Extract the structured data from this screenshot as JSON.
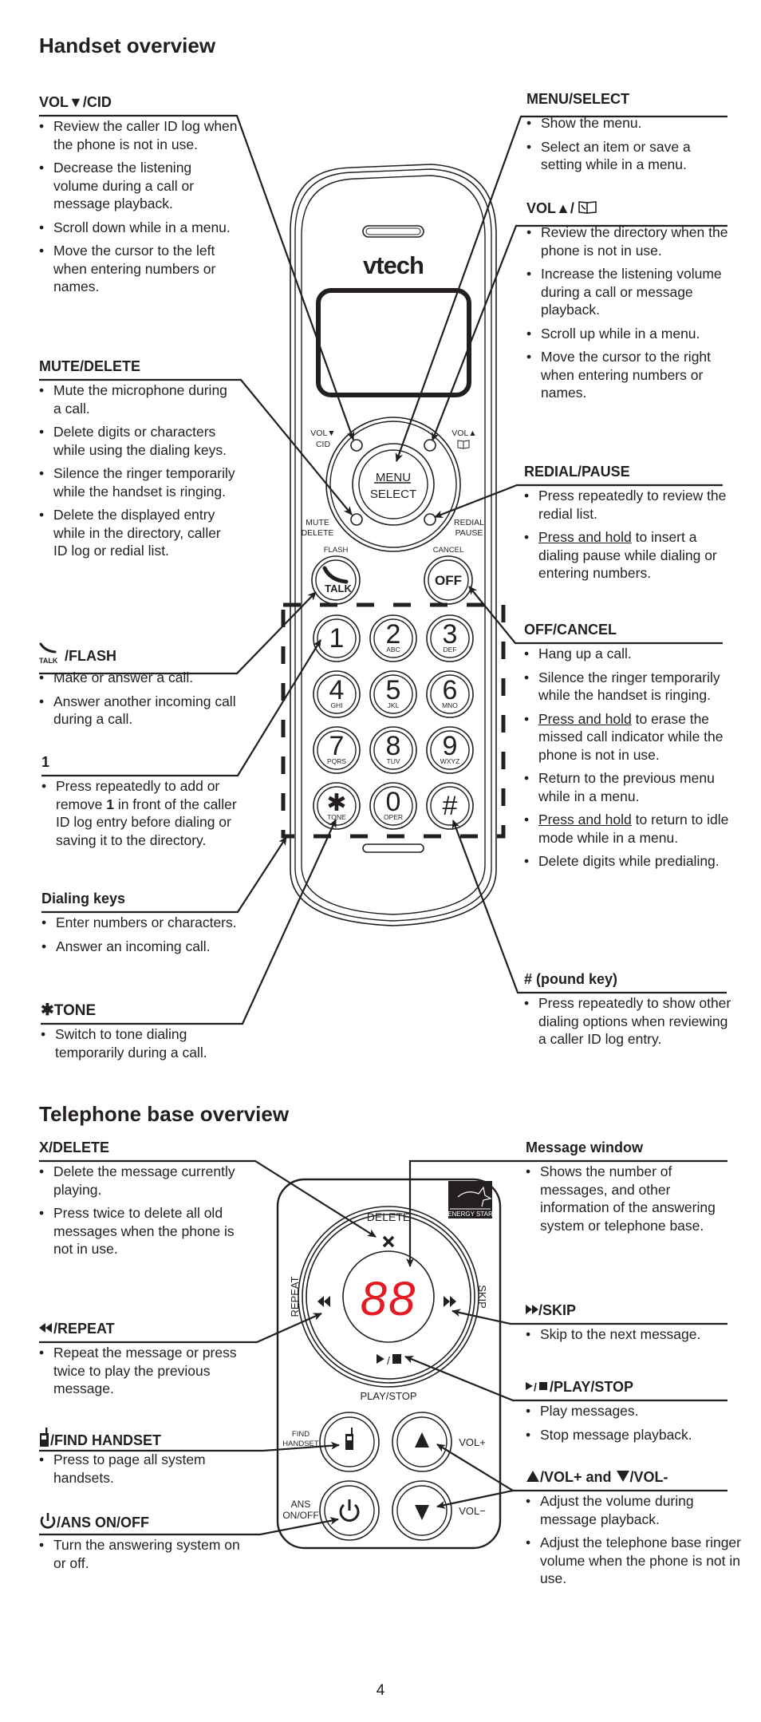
{
  "handset": {
    "heading": "Handset overview",
    "brand": "vtech",
    "keypad": [
      {
        "digit": "1",
        "letters": ""
      },
      {
        "digit": "2",
        "letters": "ABC"
      },
      {
        "digit": "3",
        "letters": "DEF"
      },
      {
        "digit": "4",
        "letters": "GHI"
      },
      {
        "digit": "5",
        "letters": "JKL"
      },
      {
        "digit": "6",
        "letters": "MNO"
      },
      {
        "digit": "7",
        "letters": "PQRS"
      },
      {
        "digit": "8",
        "letters": "TUV"
      },
      {
        "digit": "9",
        "letters": "WXYZ"
      },
      {
        "digit": "✱",
        "letters": "TONE"
      },
      {
        "digit": "0",
        "letters": "OPER"
      },
      {
        "digit": "#",
        "letters": ""
      }
    ],
    "labels": {
      "vol_down": "VOL▼",
      "cid": "CID",
      "vol_up": "VOL▲",
      "menu": "MENU",
      "select": "SELECT",
      "mute": "MUTE",
      "delete": "DELETE",
      "redial": "REDIAL",
      "pause": "PAUSE",
      "flash": "FLASH",
      "talk": "TALK",
      "cancel": "CANCEL",
      "off": "OFF"
    },
    "callouts": {
      "vol_cid": {
        "title": "VOL▼/CID",
        "items": [
          "Review the caller ID log when the phone is not in use.",
          "Decrease the listening volume during a call or message playback.",
          "Scroll down while in a menu.",
          "Move the cursor to the left when entering numbers or names."
        ]
      },
      "mute_delete": {
        "title": "MUTE/DELETE",
        "items": [
          "Mute the microphone during a call.",
          "Delete digits or characters while using the dialing keys.",
          "Silence the ringer temporarily while the handset is ringing.",
          "Delete the displayed entry while in the directory, caller ID log or redial list."
        ]
      },
      "talk_flash": {
        "title_icon_label": "TALK",
        "title": "/FLASH",
        "items": [
          "Make or answer a call.",
          "Answer another incoming call during a call."
        ]
      },
      "one": {
        "title": "1",
        "item_pre": "Press repeatedly to add or remove ",
        "item_bold": "1",
        "item_post": " in front of the caller ID log entry before dialing or saving it to the directory."
      },
      "dialing_keys": {
        "title": "Dialing keys",
        "items": [
          "Enter numbers or characters.",
          "Answer an incoming call."
        ]
      },
      "tone": {
        "title_icon": "✱",
        "title": "TONE",
        "items": [
          "Switch to tone dialing temporarily during a call."
        ]
      },
      "menu_select": {
        "title": "MENU/SELECT",
        "items": [
          "Show the menu.",
          "Select an item or save a setting while in a menu."
        ]
      },
      "vol_directory": {
        "title": "VOL▲/",
        "items": [
          "Review the directory when the phone is not in use.",
          "Increase the listening volume during a call or message playback.",
          "Scroll up while in a menu.",
          "Move the cursor to the right when entering numbers or names."
        ]
      },
      "redial_pause": {
        "title": "REDIAL/PAUSE",
        "item1": "Press repeatedly to review the redial list.",
        "item2_u": "Press and hold",
        "item2_rest": " to insert a dialing pause while dialing or entering numbers."
      },
      "off_cancel": {
        "title": "OFF/CANCEL",
        "item1": "Hang up a call.",
        "item2": "Silence the ringer temporarily while the handset is ringing.",
        "item3_u": "Press and hold",
        "item3_rest": " to erase the missed call indicator while the phone is not in use.",
        "item4": "Return to the previous menu while in a menu.",
        "item5_u": "Press and hold",
        "item5_rest": " to return to idle mode while in a menu.",
        "item6": "Delete digits while predialing."
      },
      "pound": {
        "title": "# (pound key)",
        "items": [
          "Press repeatedly to show other dialing options when reviewing a caller ID log entry."
        ]
      }
    }
  },
  "base": {
    "heading": "Telephone base overview",
    "display_value": "88",
    "display_color": "#e31b23",
    "energy_star": "ENERGY STAR",
    "labels": {
      "delete": "DELETE",
      "repeat": "REPEAT",
      "skip": "SKIP",
      "play_stop": "PLAY/STOP",
      "find1": "FIND",
      "find2": "HANDSET",
      "ans1": "ANS",
      "ans2": "ON/OFF",
      "vol_plus": "VOL+",
      "vol_minus": "VOL−"
    },
    "callouts": {
      "x_delete": {
        "title": "X/DELETE",
        "items": [
          "Delete the message currently playing.",
          "Press twice to delete all old messages when the phone is not in use."
        ]
      },
      "repeat": {
        "title": "/REPEAT",
        "items": [
          "Repeat the message or press twice to play the previous message."
        ]
      },
      "find_handset": {
        "title": "/FIND HANDSET",
        "items": [
          "Press to page all system handsets."
        ]
      },
      "ans_onoff": {
        "title": "/ANS ON/OFF",
        "items": [
          "Turn the answering system on or off."
        ]
      },
      "message_window": {
        "title": "Message window",
        "items": [
          "Shows the number of messages, and other information of the answering system or telephone base."
        ]
      },
      "skip": {
        "title": "/SKIP",
        "items": [
          "Skip to the next message."
        ]
      },
      "play_stop": {
        "title": "/PLAY/STOP",
        "items": [
          "Play messages.",
          "Stop message playback."
        ]
      },
      "volume": {
        "title_a": "/VOL+ and ",
        "title_b": "/VOL-",
        "items": [
          "Adjust the volume during message playback.",
          "Adjust the telephone base ringer volume when the phone is not in use."
        ]
      }
    }
  },
  "page_number": "4"
}
